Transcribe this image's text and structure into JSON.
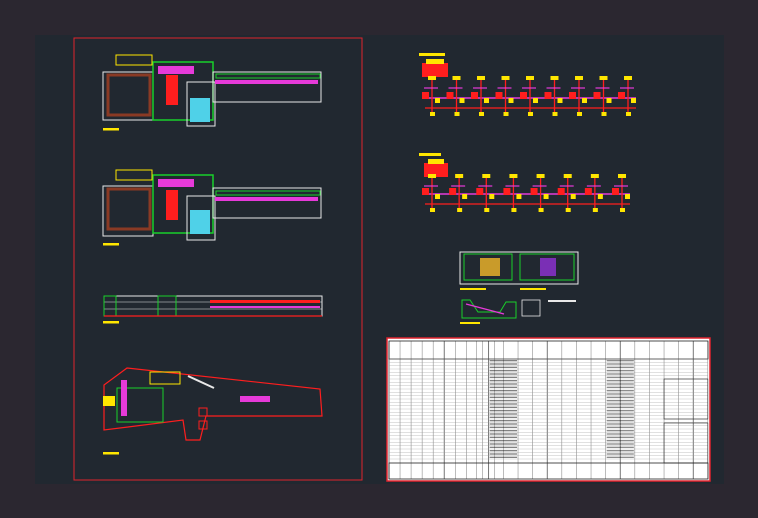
{
  "colors": {
    "window_bg": "#2b2730",
    "viewport_bg": "#212830",
    "sheet_border": "#e0232d",
    "table_paper": "#ffffff",
    "wall_green": "#19d02a",
    "pipe_magenta": "#e63ad9",
    "pipe_red": "#ff1e1e",
    "label_yellow": "#ffe600",
    "stair_cyan": "#4fd1e8",
    "lines_white": "#e8e8e8"
  },
  "viewport": {
    "name": "model-space"
  },
  "left_sheet": {
    "views": [
      {
        "id": "floor-plan-1",
        "icon": "floor-plan-drawing"
      },
      {
        "id": "floor-plan-2",
        "icon": "floor-plan-drawing"
      },
      {
        "id": "building-section",
        "icon": "section-drawing"
      },
      {
        "id": "site-plan",
        "icon": "site-plan-drawing"
      }
    ]
  },
  "right_sheet": {
    "riser_diagrams": [
      {
        "id": "riser-diagram-1",
        "icon": "pipe-riser-diagram",
        "branches": 9
      },
      {
        "id": "riser-diagram-2",
        "icon": "pipe-riser-diagram",
        "branches": 8
      }
    ],
    "details": [
      {
        "id": "tank-room-detail",
        "icon": "detail-drawing"
      },
      {
        "id": "trench-detail",
        "icon": "detail-drawing"
      }
    ],
    "schedule_table": {
      "icon": "schedule-table",
      "columns": 26,
      "rows": 30
    }
  }
}
